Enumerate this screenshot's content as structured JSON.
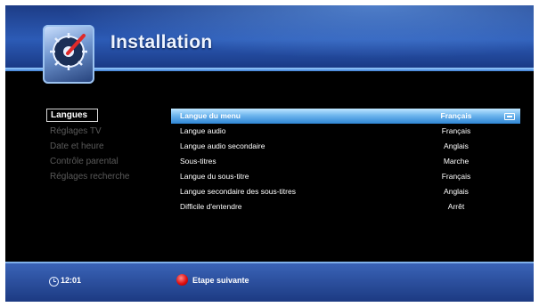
{
  "header": {
    "title": "Installation",
    "icon": "settings-gauge-icon"
  },
  "categories": [
    {
      "label": "Langues",
      "active": true
    },
    {
      "label": "Réglages TV",
      "active": false
    },
    {
      "label": "Date et heure",
      "active": false
    },
    {
      "label": "Contrôle parental",
      "active": false
    },
    {
      "label": "Réglages recherche",
      "active": false
    }
  ],
  "settings": [
    {
      "label": "Langue du menu",
      "value": "Français",
      "selected": true
    },
    {
      "label": "Langue audio",
      "value": "Français",
      "selected": false
    },
    {
      "label": "Langue audio secondaire",
      "value": "Anglais",
      "selected": false
    },
    {
      "label": "Sous-titres",
      "value": "Marche",
      "selected": false
    },
    {
      "label": "Langue du sous-titre",
      "value": "Français",
      "selected": false
    },
    {
      "label": "Langue secondaire des sous-titres",
      "value": "Anglais",
      "selected": false
    },
    {
      "label": "Difficile d'entendre",
      "value": "Arrêt",
      "selected": false
    }
  ],
  "footer": {
    "time": "12:01",
    "red_button_label": "Etape suivante",
    "icons": [
      "clock-icon",
      "red-button-icon"
    ]
  },
  "colors": {
    "header_blue": "#2c5bb6",
    "selection_blue": "#6fb6ee",
    "footer_blue": "#2a4f9e",
    "red_button": "#e01010"
  }
}
